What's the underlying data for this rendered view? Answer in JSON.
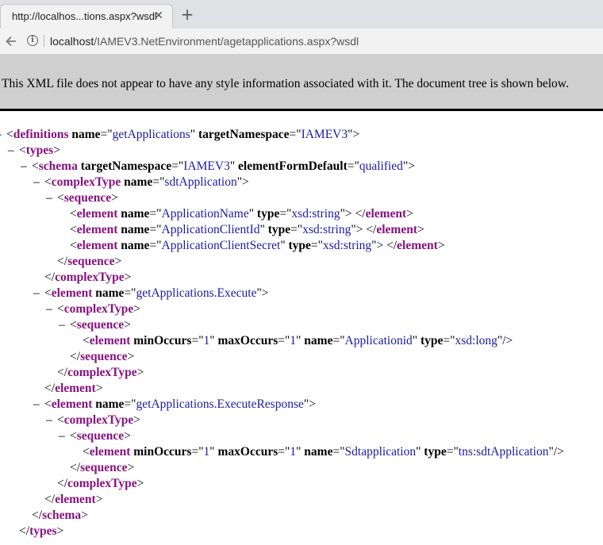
{
  "tab": {
    "title": "http://localhos...tions.aspx?wsdl",
    "close": "✕",
    "new_tab": "+"
  },
  "address_bar": {
    "host": "localhost",
    "path": "/IAMEV3.NetEnvironment/agetapplications.aspx?wsdl"
  },
  "notice": "This XML file does not appear to have any style information associated with it. The document tree is shown below.",
  "colors": {
    "tag": "#881280",
    "attr_value": "#1a1aa6",
    "notice_bg": "#cfcfcf"
  },
  "icons": [
    "back-arrow-icon",
    "info-icon",
    "close-icon",
    "plus-icon"
  ],
  "xml": {
    "definitions": {
      "tag": "definitions",
      "attr1": "name",
      "val1": "getApplications",
      "attr2": "targetNamespace",
      "val2": "IAMEV3"
    },
    "types": {
      "tag": "types"
    },
    "schema": {
      "tag": "schema",
      "attr1": "targetNamespace",
      "val1": "IAMEV3",
      "attr2": "elementFormDefault",
      "val2": "qualified"
    },
    "ct1": {
      "tag": "complexType",
      "attr1": "name",
      "val1": "sdtApplication"
    },
    "seq1": {
      "tag": "sequence"
    },
    "el_appname": {
      "tag": "element",
      "attr1": "name",
      "val1": "ApplicationName",
      "attr2": "type",
      "val2": "xsd:string"
    },
    "el_clientid": {
      "tag": "element",
      "attr1": "name",
      "val1": "ApplicationClientId",
      "attr2": "type",
      "val2": "xsd:string"
    },
    "el_secret": {
      "tag": "element",
      "attr1": "name",
      "val1": "ApplicationClientSecret",
      "attr2": "type",
      "val2": "xsd:string"
    },
    "el_exec": {
      "tag": "element",
      "attr1": "name",
      "val1": "getApplications.Execute"
    },
    "ct2": {
      "tag": "complexType"
    },
    "seq2": {
      "tag": "sequence"
    },
    "el_appid": {
      "tag": "element",
      "attr1": "minOccurs",
      "val1": "1",
      "attr2": "maxOccurs",
      "val2": "1",
      "attr3": "name",
      "val3": "Applicationid",
      "attr4": "type",
      "val4": "xsd:long"
    },
    "el_resp": {
      "tag": "element",
      "attr1": "name",
      "val1": "getApplications.ExecuteResponse"
    },
    "ct3": {
      "tag": "complexType"
    },
    "seq3": {
      "tag": "sequence"
    },
    "el_sdtapp": {
      "tag": "element",
      "attr1": "minOccurs",
      "val1": "1",
      "attr2": "maxOccurs",
      "val2": "1",
      "attr3": "name",
      "val3": "Sdtapplication",
      "attr4": "type",
      "val4": "tns:sdtApplication"
    },
    "fold_symbol": "–"
  }
}
